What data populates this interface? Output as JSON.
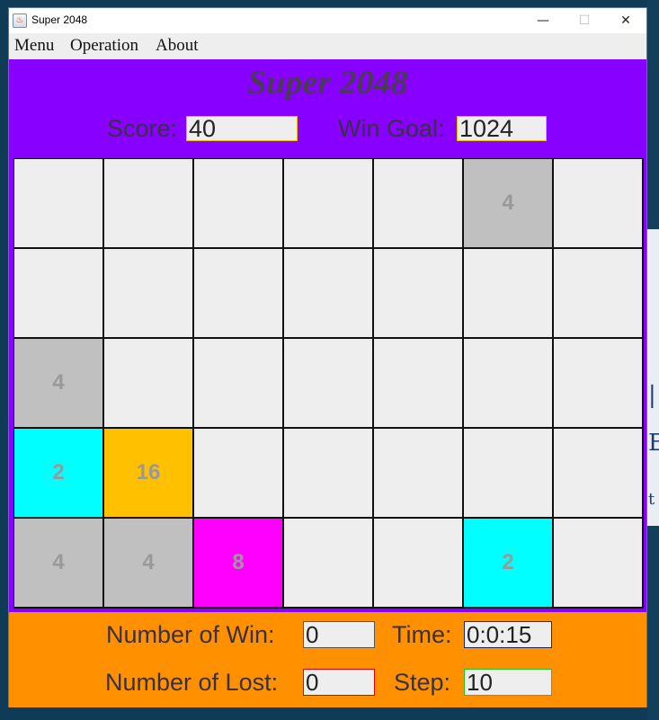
{
  "window": {
    "title": "Super 2048"
  },
  "title_controls": {
    "minimize": "—",
    "maximize": "☐",
    "close": "✕"
  },
  "menubar": {
    "items": [
      "Menu",
      "Operation",
      "About"
    ]
  },
  "header": {
    "title": "Super 2048",
    "score_label": "Score:",
    "score_value": "40",
    "goal_label": "Win Goal:",
    "goal_value": "1024"
  },
  "board": {
    "rows": 5,
    "cols": 7,
    "cells": [
      [
        "",
        "",
        "",
        "",
        "",
        "4",
        ""
      ],
      [
        "",
        "",
        "",
        "",
        "",
        "",
        ""
      ],
      [
        "4",
        "",
        "",
        "",
        "",
        "",
        ""
      ],
      [
        "2",
        "16",
        "",
        "",
        "",
        "",
        ""
      ],
      [
        "4",
        "4",
        "8",
        "",
        "",
        "2",
        ""
      ]
    ],
    "tile_colors": {
      "2": "#00ffff",
      "4": "#c0c0c0",
      "8": "#ff00ff",
      "16": "#ffc000"
    },
    "empty_color": "#eeeeee",
    "number_color": "#999999"
  },
  "stats": {
    "wins_label": "Number of Win:",
    "wins_value": "0",
    "time_label": "Time:",
    "time_value": "0:0:15",
    "lost_label": "Number of Lost:",
    "lost_value": "0",
    "step_label": "Step:",
    "step_value": "10"
  },
  "colors": {
    "panel_purple": "#8800ff",
    "panel_orange": "#ff9000"
  }
}
